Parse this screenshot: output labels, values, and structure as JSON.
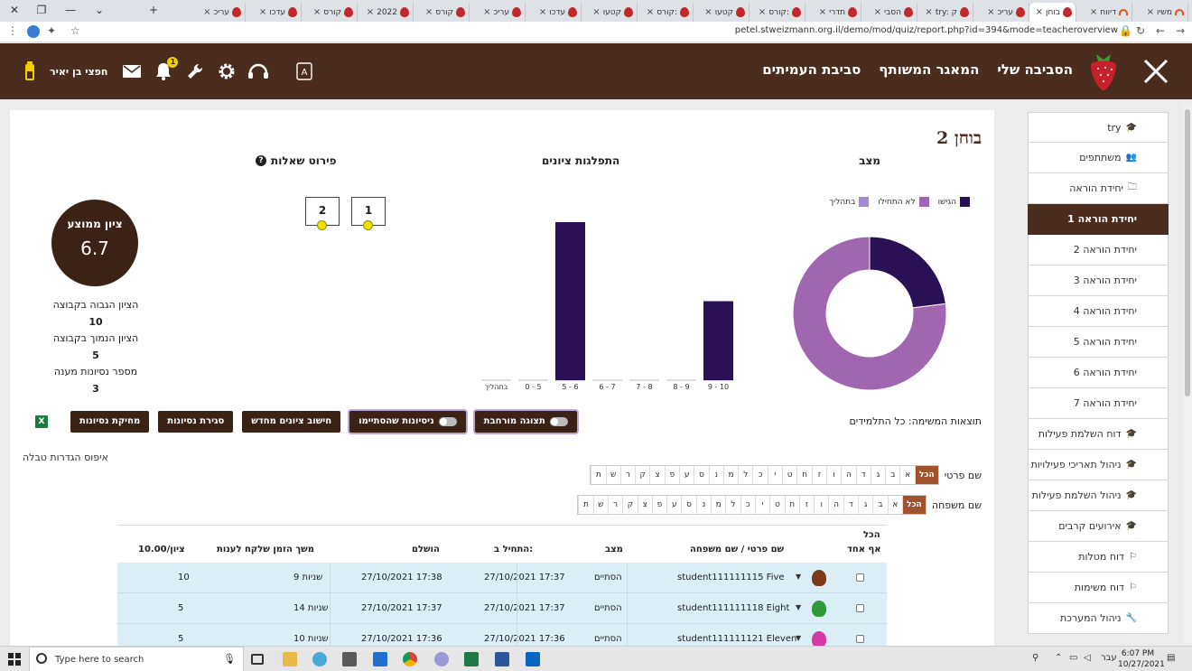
{
  "browser": {
    "tabs": [
      {
        "label": "משיו",
        "fav": "moodle"
      },
      {
        "label": "דיווח",
        "fav": "moodle"
      },
      {
        "label": "בוחן",
        "fav": "strawberry",
        "active": true
      },
      {
        "label": "עריכ",
        "fav": "strawberry"
      },
      {
        "label": "try: ק",
        "fav": "strawberry"
      },
      {
        "label": "הסבי",
        "fav": "strawberry"
      },
      {
        "label": "תדרי",
        "fav": "strawberry"
      },
      {
        "label": "קורס:",
        "fav": "strawberry"
      },
      {
        "label": "קטעו",
        "fav": "strawberry"
      },
      {
        "label": "קורס:",
        "fav": "strawberry"
      },
      {
        "label": "קטעו",
        "fav": "strawberry"
      },
      {
        "label": "עדכו",
        "fav": "strawberry"
      },
      {
        "label": "עריכ",
        "fav": "strawberry"
      },
      {
        "label": "קורס",
        "fav": "strawberry"
      },
      {
        "label": "2022",
        "fav": "strawberry"
      },
      {
        "label": "קורס",
        "fav": "strawberry"
      },
      {
        "label": "עדכו",
        "fav": "strawberry"
      },
      {
        "label": "עריכ",
        "fav": "strawberry"
      }
    ],
    "url": "petel.stweizmann.org.il/demo/mod/quiz/report.php?id=394&mode=teacheroverview"
  },
  "header": {
    "nav": [
      "הסביבה שלי",
      "המאגר המשותף",
      "סביבת העמיתים"
    ],
    "username": "חפצי בן יאיר",
    "notifications": "1"
  },
  "sidebar": {
    "items": [
      {
        "label": "try",
        "icon": "graduation-cap-icon",
        "glyph": "🎓"
      },
      {
        "label": "משתתפים",
        "icon": "users-icon",
        "glyph": "👥"
      },
      {
        "label": "יחידת הוראה",
        "icon": "folder-icon",
        "glyph": "🗀"
      },
      {
        "label": "יחידת הוראה 1",
        "active": true
      },
      {
        "label": "יחידת הוראה 2"
      },
      {
        "label": "יחידת הוראה 3"
      },
      {
        "label": "יחידת הוראה 4"
      },
      {
        "label": "יחידת הוראה 5"
      },
      {
        "label": "יחידת הוראה 6"
      },
      {
        "label": "יחידת הוראה 7"
      },
      {
        "label": "דוח השלמת פעילות",
        "icon": "graduation-cap-icon",
        "glyph": "🎓"
      },
      {
        "label": "ניהול תאריכי פעילויות",
        "icon": "graduation-cap-icon",
        "glyph": "🎓"
      },
      {
        "label": "ניהול השלמת פעילות",
        "icon": "graduation-cap-icon",
        "glyph": "🎓"
      },
      {
        "label": "אירועים קרבים",
        "icon": "graduation-cap-icon",
        "glyph": "🎓"
      },
      {
        "label": "דוח מטלות",
        "icon": "flag-icon",
        "glyph": "⚐"
      },
      {
        "label": "דוח משימות",
        "icon": "flag-icon",
        "glyph": "⚐"
      },
      {
        "label": "ניהול המערכת",
        "icon": "wrench-icon",
        "glyph": "🔧"
      }
    ]
  },
  "main": {
    "title": "בוחן 2",
    "status_title": "מצב",
    "distribution_title": "התפלגות ציונים",
    "questions_title": "פירוט שאלות",
    "question_boxes": [
      "1",
      "2"
    ],
    "avg_label": "ציון ממוצע",
    "avg_value": "6.7",
    "stats": [
      {
        "label": "הציון הגבוה בקבוצה",
        "value": "10"
      },
      {
        "label": "הציון הנמוך בקבוצה",
        "value": "5"
      },
      {
        "label": "מספר נסיונות מענה",
        "value": "3"
      }
    ],
    "overview_text": "תוצאות המשימה: כל התלמידים",
    "buttons": {
      "expanded": "תצוגה מורחבת",
      "finished_attempts": "ניסיונות שהסתיימו",
      "regrade": "חישוב ציונים מחדש",
      "close_attempts": "סגירת נסיונות",
      "delete_attempts": "מחיקת נסיונות"
    },
    "reset_link": "איפוס הגדרות טבלה",
    "firstname_label": "שם פרטי",
    "lastname_label": "שם משפחה",
    "all_label": "הכל",
    "letters": [
      "א",
      "ב",
      "ג",
      "ד",
      "ה",
      "ו",
      "ז",
      "ח",
      "ט",
      "י",
      "כ",
      "ל",
      "מ",
      "נ",
      "ס",
      "ע",
      "פ",
      "צ",
      "ק",
      "ר",
      "ש",
      "ת"
    ]
  },
  "table": {
    "headers": {
      "select_all": "הכל",
      "none": "אף אחד",
      "name": "שם פרטי / שם משפחה",
      "state": "מצב",
      "started": "התחיל ב:",
      "completed": "הושלם",
      "duration": "משך הזמן שלקח לענות",
      "grade": "ציון/10.00"
    },
    "rows": [
      {
        "name": "student111111115 Five",
        "state": "הסתיים",
        "started": "27/10/2021 17:37",
        "completed": "27/10/2021 17:38",
        "duration": "9 שניות",
        "grade": "10",
        "avatar": "#7a3b1c"
      },
      {
        "name": "student111111118 Eight",
        "state": "הסתיים",
        "started": "27/10/2021 17:37",
        "completed": "27/10/2021 17:37",
        "duration": "14 שניות",
        "grade": "5",
        "avatar": "#2e9a3a"
      },
      {
        "name": "student111111121 Eleven",
        "state": "הסתיים",
        "started": "27/10/2021 17:36",
        "completed": "27/10/2021 17:36",
        "duration": "10 שניות",
        "grade": "5",
        "avatar": "#d43aa6"
      }
    ]
  },
  "chart_data": [
    {
      "type": "pie",
      "title": "מצב",
      "categories": [
        "הגישו",
        "לא התחילו",
        "בתהליך"
      ],
      "values": [
        23,
        77,
        0
      ],
      "colors": [
        "#2a1155",
        "#a066b0",
        "#a48ad0"
      ],
      "legend_position": "top"
    },
    {
      "type": "bar",
      "title": "התפלגות ציונים",
      "categories": [
        "9 - 10",
        "8 - 9",
        "7 - 8",
        "6 - 7",
        "5 - 6",
        "0 - 5",
        "בתהליך"
      ],
      "values": [
        1,
        0,
        0,
        0,
        2,
        0,
        0
      ],
      "color": "#2a1155",
      "ylim": [
        0,
        2
      ]
    }
  ],
  "taskbar": {
    "search_placeholder": "Type here to search",
    "time": "6:07 PM",
    "date": "10/27/2021",
    "lang": "עבר"
  }
}
